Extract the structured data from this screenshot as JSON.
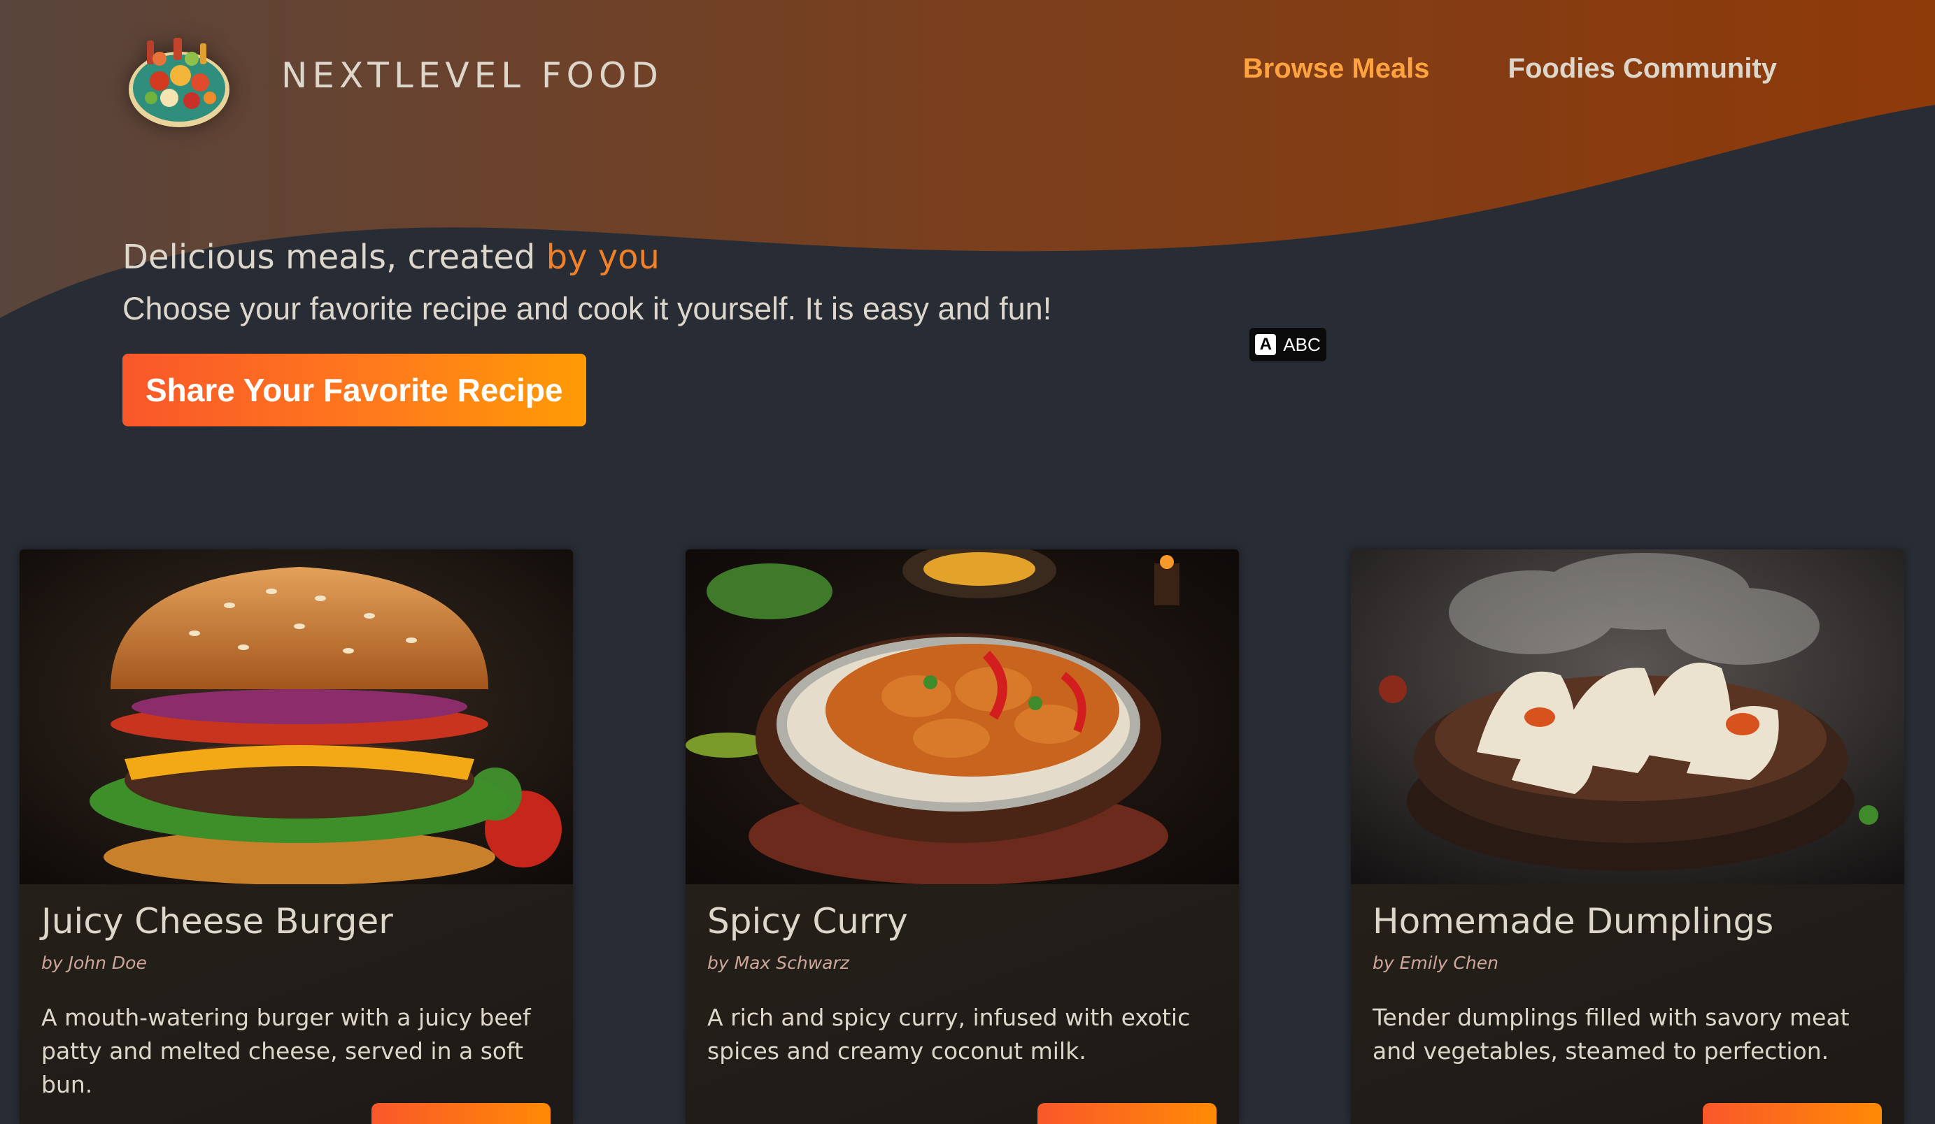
{
  "header": {
    "logo_alt": "A plate with food on it",
    "brand": "NEXTLEVEL FOOD",
    "nav": [
      {
        "label": "Browse Meals",
        "active": true
      },
      {
        "label": "Foodies Community",
        "active": false
      }
    ]
  },
  "hero": {
    "title_prefix": "Delicious meals, created ",
    "title_accent": "by you",
    "subtitle": "Choose your favorite recipe and cook it yourself. It is easy and fun!",
    "cta_label": "Share Your Favorite Recipe"
  },
  "overlay_chip": {
    "icon_letter": "A",
    "label": "ABC"
  },
  "meals": [
    {
      "title": "Juicy Cheese Burger",
      "creator": "by John Doe",
      "summary": "A mouth-watering burger with a juicy beef patty and melted cheese, served in a soft bun.",
      "image_icon": "burger-image"
    },
    {
      "title": "Spicy Curry",
      "creator": "by Max Schwarz",
      "summary": "A rich and spicy curry, infused with exotic spices and creamy coconut milk.",
      "image_icon": "curry-image"
    },
    {
      "title": "Homemade Dumplings",
      "creator": "by Emily Chen",
      "summary": "Tender dumplings filled with savory meat and vegetables, steamed to perfection.",
      "image_icon": "dumplings-image"
    }
  ],
  "colors": {
    "background": "#282c34",
    "accent": "#ffa341",
    "accent_text": "#f08129",
    "button_start": "#f9572a",
    "button_end": "#ff9b05",
    "text": "#ddd6cb"
  }
}
